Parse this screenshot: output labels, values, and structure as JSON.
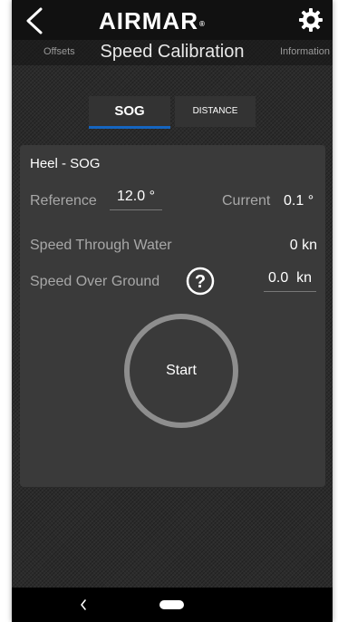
{
  "header": {
    "logo_text": "AIRMAR",
    "logo_mark": "®",
    "back_icon": "chevron-left-icon",
    "settings_icon": "gear-icon"
  },
  "subnav": {
    "left_link": "Offsets",
    "title": "Speed Calibration",
    "right_link": "Information"
  },
  "tabs": [
    {
      "label": "SOG",
      "active": true
    },
    {
      "label": "DISTANCE",
      "active": false
    }
  ],
  "card": {
    "title": "Heel - SOG",
    "reference_label": "Reference",
    "reference_value": "12.0 °",
    "current_label": "Current",
    "current_value": "0.1 °",
    "stw_label": "Speed Through Water",
    "stw_value": "0 kn",
    "sog_label": "Speed Over Ground",
    "sog_value": "0.0  kn",
    "help_icon": "question-circle-icon",
    "start_label": "Start"
  },
  "navbar": {
    "back_icon": "nav-back-icon",
    "home_icon": "nav-home-pill-icon"
  },
  "colors": {
    "accent": "#1565c0",
    "background": "#2b2b2b",
    "card": "#3a3a3a",
    "ring": "#8e8e8e"
  }
}
